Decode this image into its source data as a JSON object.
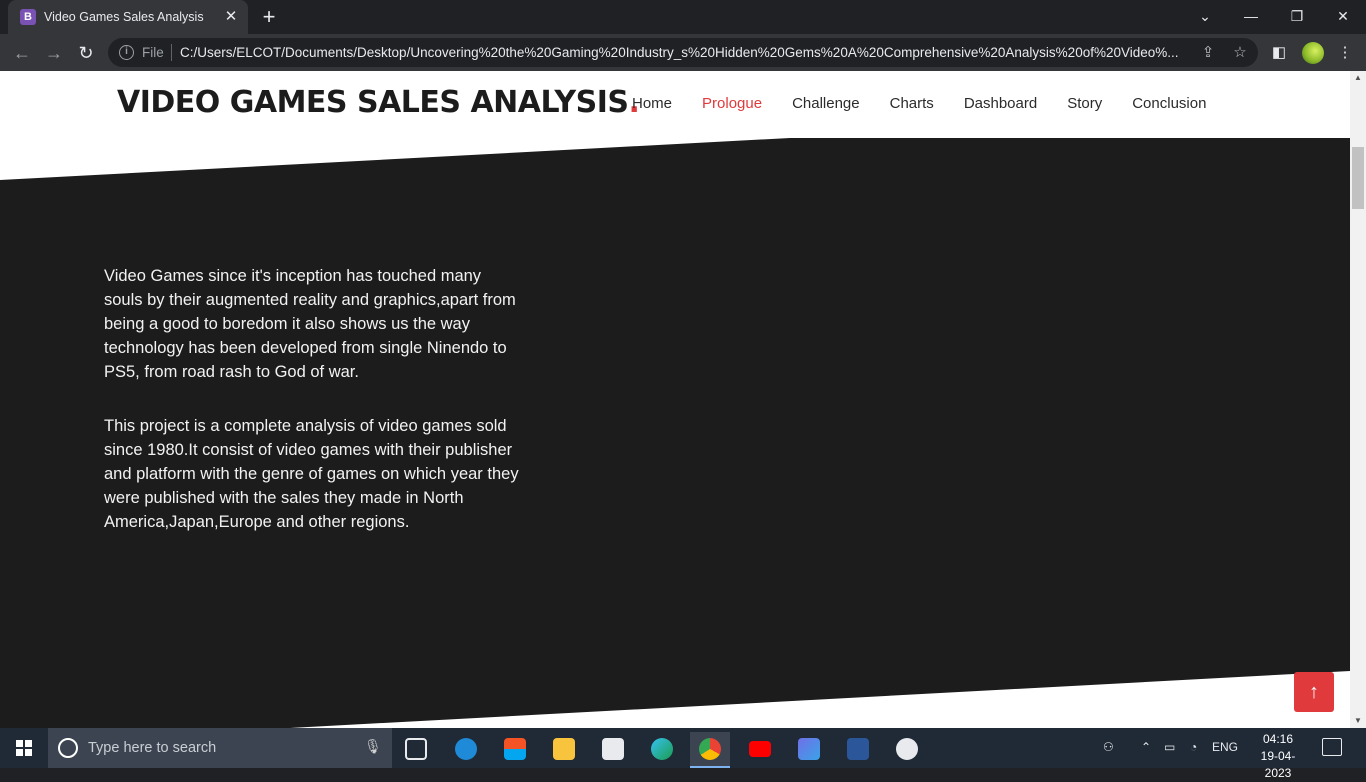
{
  "browser": {
    "tab_title": "Video Games Sales Analysis",
    "tab_favicon": "B",
    "file_label": "File",
    "url": "C:/Users/ELCOT/Documents/Desktop/Uncovering%20the%20Gaming%20Industry_s%20Hidden%20Gems%20A%20Comprehensive%20Analysis%20of%20Video%..."
  },
  "site": {
    "logo_text": "VIDEO GAMES SALES ANALYSIS",
    "logo_dot": ".",
    "nav": [
      {
        "label": "Home",
        "active": false
      },
      {
        "label": "Prologue",
        "active": true
      },
      {
        "label": "Challenge",
        "active": false
      },
      {
        "label": "Charts",
        "active": false
      },
      {
        "label": "Dashboard",
        "active": false
      },
      {
        "label": "Story",
        "active": false
      },
      {
        "label": "Conclusion",
        "active": false
      }
    ],
    "paragraphs": [
      "Video Games since it's inception has touched many souls by their augmented reality and graphics,apart from being a good to boredom it also shows us the way technology has been developed from single Ninendo to PS5, from road rash to God of war.",
      "This project is a complete analysis of video games sold since 1980.It consist of video games with their publisher and platform with the genre of games on which year they were published with the sales they made in North America,Japan,Europe and other regions."
    ],
    "scroll_top_icon": "arrow-up-icon"
  },
  "colors": {
    "accent": "#e03a3c",
    "section_bg": "#1c1c1d",
    "header_bg": "#ffffff"
  },
  "taskbar": {
    "search_placeholder": "Type here to search",
    "language": "ENG",
    "time": "04:16",
    "date": "19-04-2023"
  }
}
